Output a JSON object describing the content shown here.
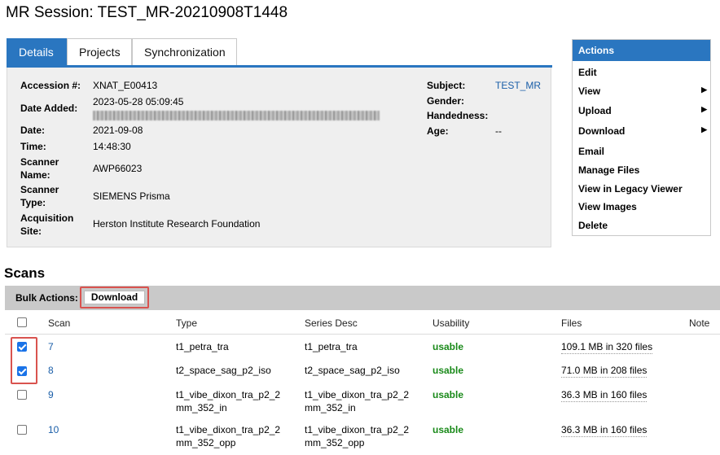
{
  "page_title": "MR Session: TEST_MR-20210908T1448",
  "tabs": [
    "Details",
    "Projects",
    "Synchronization"
  ],
  "details": {
    "accession_label": "Accession #:",
    "accession_value": "XNAT_E00413",
    "date_added_label": "Date Added:",
    "date_added_value": "2023-05-28 05:09:45",
    "date_label": "Date:",
    "date_value": "2021-09-08",
    "time_label": "Time:",
    "time_value": "14:48:30",
    "scanner_name_label_1": "Scanner",
    "scanner_name_label_2": "Name:",
    "scanner_name_value": "AWP66023",
    "scanner_type_label_1": "Scanner",
    "scanner_type_label_2": "Type:",
    "scanner_type_value": "SIEMENS Prisma",
    "acq_site_label_1": "Acquisition",
    "acq_site_label_2": "Site:",
    "acq_site_value": "Herston Institute Research Foundation",
    "subject_label": "Subject:",
    "subject_value": "TEST_MR",
    "gender_label": "Gender:",
    "handedness_label": "Handedness:",
    "age_label": "Age:",
    "age_value": "--"
  },
  "actions": {
    "header": "Actions",
    "items": [
      "Edit",
      "View",
      "Upload",
      "Download",
      "Email",
      "Manage Files",
      "View in Legacy Viewer",
      "View Images",
      "Delete"
    ],
    "submenu_arrow": "▶"
  },
  "scans": {
    "title": "Scans",
    "bulk_label": "Bulk Actions:",
    "download_button": "Download",
    "headers": [
      "Scan",
      "Type",
      "Series Desc",
      "Usability",
      "Files",
      "Note"
    ],
    "rows": [
      {
        "scan": "7",
        "type1": "t1_petra_tra",
        "type2": "",
        "desc1": "t1_petra_tra",
        "desc2": "",
        "usability": "usable",
        "files": "109.1 MB in 320 files",
        "checked": true
      },
      {
        "scan": "8",
        "type1": "t2_space_sag_p2_iso",
        "type2": "",
        "desc1": "t2_space_sag_p2_iso",
        "desc2": "",
        "usability": "usable",
        "files": "71.0 MB in 208 files",
        "checked": true
      },
      {
        "scan": "9",
        "type1": "t1_vibe_dixon_tra_p2_2",
        "type2": "mm_352_in",
        "desc1": "t1_vibe_dixon_tra_p2_2",
        "desc2": "mm_352_in",
        "usability": "usable",
        "files": "36.3 MB in 160 files",
        "checked": false
      },
      {
        "scan": "10",
        "type1": "t1_vibe_dixon_tra_p2_2",
        "type2": "mm_352_opp",
        "desc1": "t1_vibe_dixon_tra_p2_2",
        "desc2": "mm_352_opp",
        "usability": "usable",
        "files": "36.3 MB in 160 files",
        "checked": false
      }
    ]
  }
}
